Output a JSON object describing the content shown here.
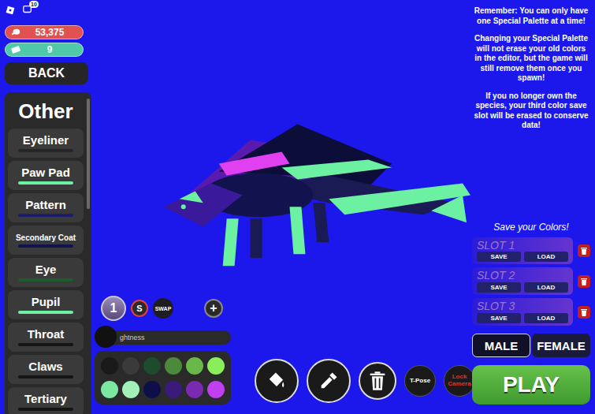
{
  "hud": {
    "badge_count": "10",
    "currencies": [
      {
        "value": "53,375",
        "color": "#e05252"
      },
      {
        "value": "9",
        "color": "#4fc9a8"
      }
    ],
    "back_button": "BACK"
  },
  "sidebar": {
    "title": "Other",
    "items": [
      {
        "label": "Eyeliner",
        "color": "#262626"
      },
      {
        "label": "Paw Pad",
        "color": "#6cf0a2"
      },
      {
        "label": "Pattern",
        "color": "#1c1c6e"
      },
      {
        "label": "Secondary Coat",
        "color": "#12124e"
      },
      {
        "label": "Eye",
        "color": "#1d5a2c"
      },
      {
        "label": "Pupil",
        "color": "#6cf0a2"
      },
      {
        "label": "Throat",
        "color": "#151515"
      },
      {
        "label": "Claws",
        "color": "#151515"
      },
      {
        "label": "Tertiary",
        "color": "#151515"
      }
    ]
  },
  "notice": [
    "Remember: You can only have one Special Palette at a time!",
    "Changing your Special Palette will not erase your old colors in the editor, but the game will still remove them once you spawn!",
    "If you no longer own the species, your third color save slot will be erased to conserve data!"
  ],
  "save_panel": {
    "title": "Save your Colors!",
    "slots": [
      {
        "label": "SLOT 1",
        "save": "SAVE",
        "load": "LOAD"
      },
      {
        "label": "SLOT 2",
        "save": "SAVE",
        "load": "LOAD"
      },
      {
        "label": "SLOT 3",
        "save": "SAVE",
        "load": "LOAD"
      }
    ]
  },
  "genders": [
    {
      "label": "MALE",
      "selected": true
    },
    {
      "label": "FEMALE",
      "selected": false
    }
  ],
  "play_button": "PLAY",
  "palette": {
    "slot_number": "1",
    "special": "S",
    "swap": "SWAP",
    "add": "+",
    "brightness_label": "ghtness",
    "brightness_level": 0,
    "swatches": [
      {
        "color": "#1a1a1a"
      },
      {
        "color": "#3a3a3a"
      },
      {
        "color": "#1e4a2e"
      },
      {
        "color": "#4a8a3a"
      },
      {
        "color": "#6ab84a"
      },
      {
        "color": "#8aee5a"
      },
      {
        "color": "#7ae8a0"
      },
      {
        "color": "#a0f0b8"
      },
      {
        "color": "#0e0e4a"
      },
      {
        "color": "#3a1a7a"
      },
      {
        "color": "#7a2ab0"
      },
      {
        "color": "#c040f0"
      }
    ]
  },
  "toolbar": [
    {
      "kind": "bucket"
    },
    {
      "kind": "dropper"
    },
    {
      "kind": "trash"
    },
    {
      "kind": "text",
      "label": "T-Pose",
      "color": "#ffffff"
    },
    {
      "kind": "text",
      "label": "Lock Camera",
      "color": "#e0302a"
    }
  ]
}
